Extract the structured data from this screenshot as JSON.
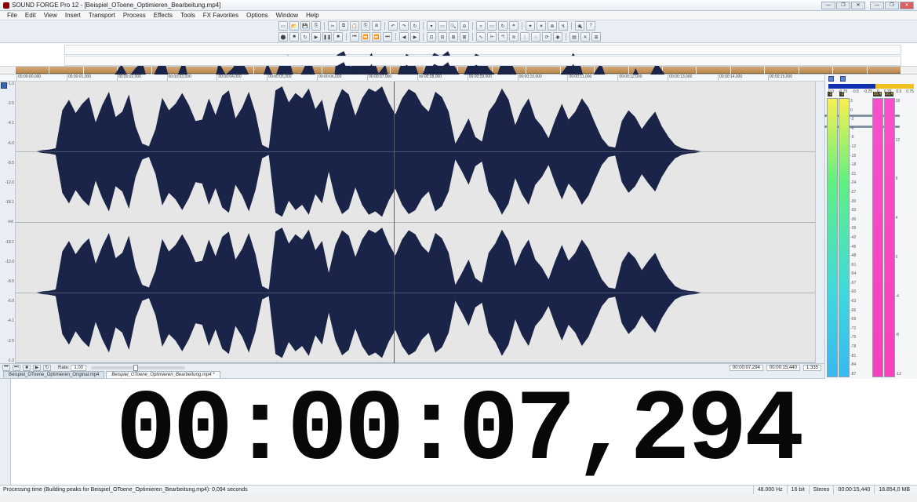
{
  "title": "SOUND FORGE Pro 12 - [Beispiel_OToene_Optimieren_Bearbeitung.mp4]",
  "menu": [
    "File",
    "Edit",
    "View",
    "Insert",
    "Transport",
    "Process",
    "Effects",
    "Tools",
    "FX Favorites",
    "Options",
    "Window",
    "Help"
  ],
  "window_controls": {
    "min": "—",
    "max": "❐",
    "close": "✕"
  },
  "toolbar": {
    "row1": [
      "new",
      "open",
      "save",
      "save-as",
      "",
      "cut",
      "copy",
      "paste",
      "paste-mix",
      "trim",
      "",
      "undo",
      "redo",
      "repeat",
      "",
      "marker",
      "selection",
      "zoom-sel",
      "zoom-out",
      "",
      "marker2",
      "region",
      "loop",
      "snap",
      "",
      "tool1",
      "tool2",
      "tool3",
      "edit",
      "",
      "plug",
      "what"
    ],
    "row2": [
      "record",
      "stop",
      "loop",
      "play",
      "pause",
      "stop2",
      "",
      "go-start",
      "rewind",
      "forward",
      "go-end",
      "",
      "prev",
      "next",
      "",
      "mode1",
      "mode2",
      "mode3",
      "mode4",
      "",
      "fx1",
      "fx2",
      "fx3",
      "fx4",
      "fx5",
      "fx6",
      "fx7",
      "fx8",
      "",
      "set1",
      "set2",
      "set3"
    ],
    "glyphs": {
      "new": "▭",
      "open": "📂",
      "save": "💾",
      "save-as": "⎘",
      "cut": "✂",
      "copy": "⧉",
      "paste": "📋",
      "paste-mix": "⎘",
      "trim": "⧈",
      "undo": "↶",
      "redo": "↷",
      "repeat": "↻",
      "marker": "▾",
      "selection": "▭",
      "zoom-sel": "🔍",
      "zoom-out": "⊖",
      "marker2": "▿",
      "region": "▭",
      "loop": "↻",
      "snap": "⌗",
      "tool1": "✦",
      "tool2": "✶",
      "tool3": "⊕",
      "edit": "↯",
      "plug": "🔌",
      "what": "?",
      "record": "⬤",
      "stop": "■",
      "play": "▶",
      "pause": "❚❚",
      "stop2": "■",
      "go-start": "⏮",
      "rewind": "⏪",
      "forward": "⏩",
      "go-end": "⏭",
      "prev": "◀",
      "next": "▶",
      "mode1": "⊡",
      "mode2": "⊟",
      "mode3": "⊞",
      "mode4": "⊠",
      "fx1": "∿",
      "fx2": "⩥",
      "fx3": "⩤",
      "fx4": "≋",
      "fx5": "⋮",
      "fx6": "∴",
      "fx7": "⟳",
      "fx8": "◉",
      "set1": "▤",
      "set2": "✕",
      "set3": "⊞"
    }
  },
  "timeline_ticks": [
    "00:00:00,000",
    "00:00:01,000",
    "00:00:02,000",
    "00:00:03,000",
    "00:00:04,000",
    "00:00:05,000",
    "00:00:06,000",
    "00:00:07,000",
    "00:00:08,000",
    "00:00:09,000",
    "00:00:10,000",
    "00:00:11,000",
    "00:00:12,000",
    "00:00:13,000",
    "00:00:14,000",
    "00:00:15,000"
  ],
  "db_scale": [
    "-1.2",
    "-2.5",
    "-4.1",
    "-6.0",
    "-8.5",
    "-12.0",
    "-18.1",
    "-Inf.",
    "-18.1",
    "-12.0",
    "-8.5",
    "-6.0",
    "-4.1",
    "-2.5",
    "-1.2"
  ],
  "cursor_time": "00:00:07,294",
  "total_time": "00:00:15,440",
  "zoom_ratio": "1:335",
  "rate_label": "Rate:",
  "rate_value": "1,00",
  "tabs": [
    {
      "label": "Beispiel_OToene_Optimieren_Original.mp4",
      "active": false
    },
    {
      "label": "Beispiel_OToene_Optimieren_Bearbeitung.mp4 *",
      "active": true
    }
  ],
  "big_time": "00:00:07,294",
  "status": {
    "left": "Processing time (Building peaks for Beispiel_OToene_Optimieren_Bearbeitung.mp4): 0,094 seconds",
    "sample_rate": "48.000 Hz",
    "bit_depth": "16 bit",
    "channels": "Stereo",
    "length": "00:00:15,440",
    "filesize": "18.854,0 MB"
  },
  "meters": {
    "top_scale": [
      "-1.1",
      "",
      "",
      "",
      "",
      "",
      "",
      "1.0"
    ],
    "top_scale_fine": [
      "0.0",
      "-0.75",
      "-0.5",
      "-0.25",
      "0",
      "0.25",
      "0.5",
      "0.75"
    ],
    "left_peak_l": "-3",
    "left_peak_r": "-3",
    "right_peak_l": "16,4",
    "right_peak_r": "16,4",
    "db_ticks": [
      "3",
      "0",
      "-3",
      "-6",
      "-9",
      "-12",
      "-15",
      "-18",
      "-21",
      "-24",
      "-27",
      "-30",
      "-33",
      "-36",
      "-39",
      "-42",
      "-45",
      "-48",
      "-51",
      "-54",
      "-57",
      "-60",
      "-63",
      "-66",
      "-69",
      "-72",
      "-75",
      "-78",
      "-81",
      "-84",
      "-87"
    ],
    "lufs_ticks": [
      "18",
      "12",
      "8",
      "4",
      "0",
      "-4",
      "-8",
      "-12"
    ]
  },
  "cursor_pct": 47.3,
  "chart_data": {
    "type": "waveform",
    "channels": 2,
    "duration_sec": 15.44,
    "cursor_sec": 7.294,
    "sample_rate_hz": 48000,
    "envelope_note": "visually-estimated normalized peak envelope (0..1), 120 points per channel, both channels near-identical",
    "points": 120,
    "envelope": [
      0.0,
      0.0,
      0.0,
      0.0,
      0.02,
      0.03,
      0.05,
      0.62,
      0.78,
      0.58,
      0.72,
      0.82,
      0.44,
      0.7,
      0.9,
      0.52,
      0.6,
      0.86,
      0.38,
      0.12,
      0.08,
      0.34,
      0.81,
      0.62,
      0.72,
      0.88,
      0.7,
      0.46,
      0.48,
      0.8,
      0.55,
      0.84,
      0.92,
      0.5,
      0.66,
      0.9,
      0.58,
      0.1,
      0.05,
      0.92,
      0.98,
      0.74,
      0.88,
      0.8,
      0.95,
      0.64,
      0.78,
      0.3,
      0.72,
      0.94,
      0.86,
      0.54,
      0.8,
      0.95,
      0.9,
      0.98,
      0.74,
      0.56,
      0.8,
      0.94,
      0.88,
      0.7,
      0.6,
      0.9,
      0.82,
      0.6,
      0.12,
      0.3,
      0.5,
      0.22,
      0.15,
      0.6,
      0.74,
      0.95,
      0.78,
      0.4,
      0.64,
      0.8,
      0.5,
      0.38,
      0.2,
      0.48,
      0.72,
      0.48,
      0.6,
      0.8,
      0.66,
      0.42,
      0.2,
      0.08,
      0.06,
      0.46,
      0.62,
      0.52,
      0.34,
      0.48,
      0.6,
      0.38,
      0.22,
      0.1,
      0.05,
      0.03,
      0.02,
      0.0,
      0.0,
      0.0,
      0.0,
      0.0,
      0.0,
      0.0,
      0.0,
      0.0,
      0.0,
      0.0,
      0.0,
      0.0,
      0.0,
      0.0,
      0.0,
      0.0
    ]
  }
}
